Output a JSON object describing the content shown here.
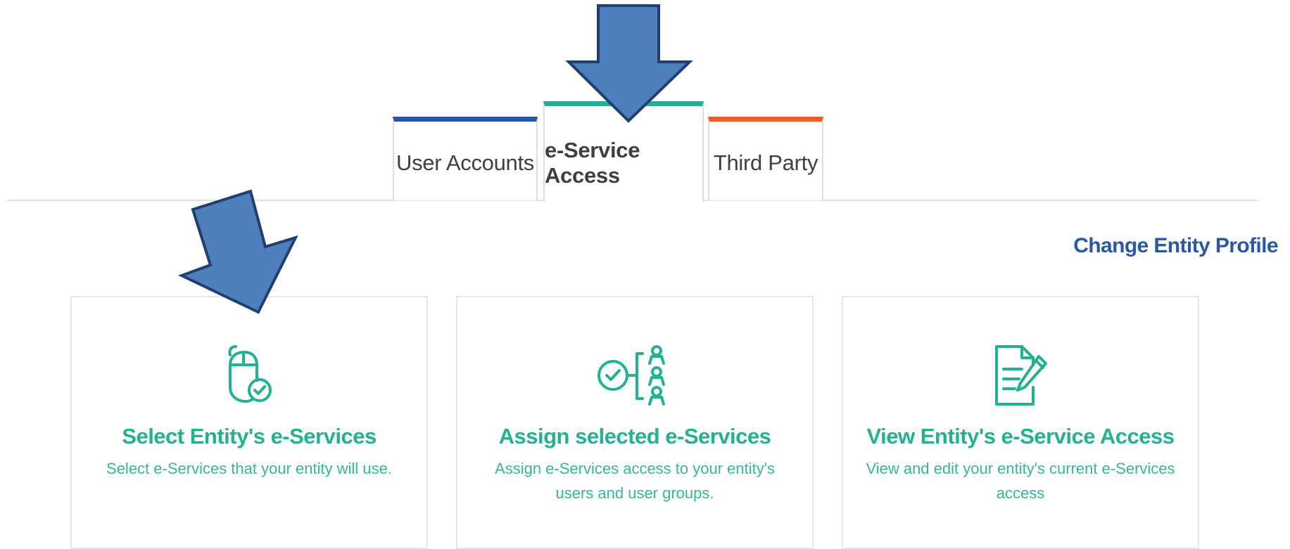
{
  "tabs": [
    {
      "label": "User Accounts",
      "color": "#2556a6",
      "active": false
    },
    {
      "label": "e-Service Access",
      "color": "#26ae93",
      "active": true
    },
    {
      "label": "Third Party",
      "color": "#ef5a2b",
      "active": false
    }
  ],
  "change_profile_link": "Change Entity Profile",
  "cards": [
    {
      "icon": "mouse-check-icon",
      "title": "Select Entity's e-Services",
      "description": "Select e-Services that your entity will use."
    },
    {
      "icon": "assign-users-icon",
      "title": "Assign selected e-Services",
      "description": "Assign e-Services access to your entity's users and user groups."
    },
    {
      "icon": "document-edit-icon",
      "title": "View Entity's e-Service Access",
      "description": "View and edit your entity's current e-Services access"
    }
  ],
  "colors": {
    "accent_green": "#22b193",
    "link_blue": "#2a58a7",
    "annotation_arrow": "#4e7fbd",
    "annotation_arrow_outline": "#203e70"
  }
}
